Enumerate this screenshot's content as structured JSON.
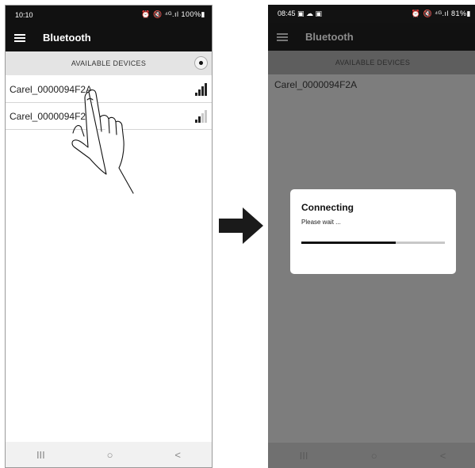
{
  "left_screen": {
    "status_time": "10:10",
    "status_icons": "⏰ 🔇 ⁴ᴳ.ıl 100%▮",
    "app_title": "Bluetooth",
    "section_header": "AVAILABLE DEVICES",
    "devices": [
      {
        "name": "Carel_0000094F2A",
        "signal_bars": 4
      },
      {
        "name": "Carel_0000094F2B",
        "signal_bars": 2
      }
    ],
    "nav": {
      "recents": "III",
      "home": "○",
      "back": "<"
    }
  },
  "right_screen": {
    "status_time": "08:45 ▣ ☁ ▣",
    "status_icons": "⏰ 🔇 ⁴ᴳ.ıl 81%▮",
    "app_title": "Bluetooth",
    "section_header": "AVAILABLE DEVICES",
    "device_name": "Carel_0000094F2A",
    "dialog": {
      "title": "Connecting",
      "message": "Please wait ...",
      "progress": 0.66
    },
    "nav": {
      "recents": "III",
      "home": "○",
      "back": "<"
    }
  },
  "colors": {
    "dark_bar": "#111111",
    "overlay": "#7d7d7d",
    "arrow": "#1a1a1a"
  }
}
